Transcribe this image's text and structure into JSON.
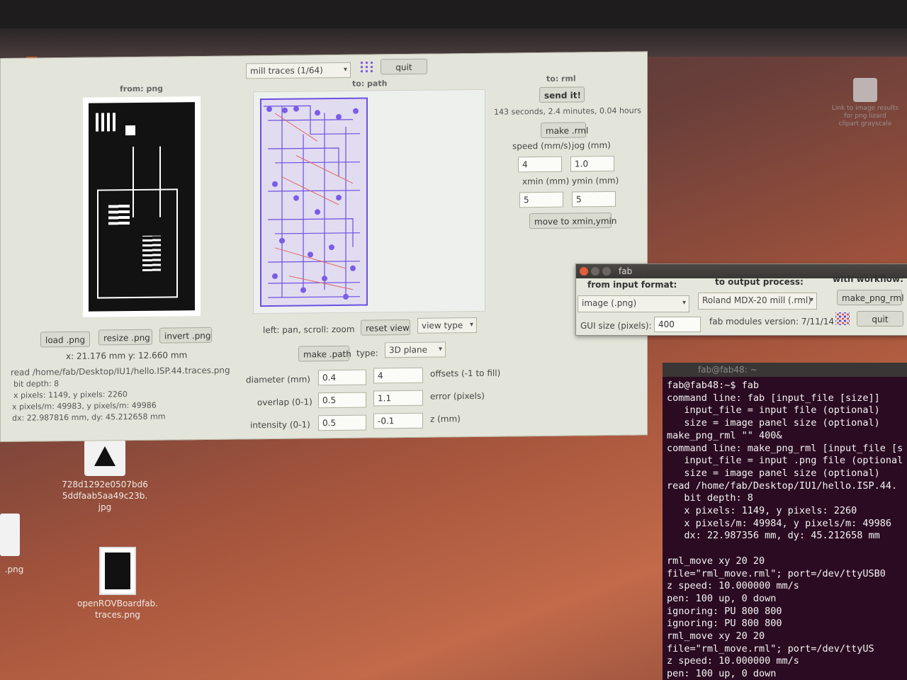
{
  "desktop": {
    "icons": [
      {
        "name": "728d1292e0507bd6\n5ddfaab5aa49c23b.\njpg"
      },
      {
        "name": "openROVBoardfab.\ntraces.png"
      },
      {
        "name": "Link to image results\nfor png lizard\nclipart grayscale"
      },
      {
        "name": ".png"
      }
    ]
  },
  "main": {
    "process_select": "mill traces (1/64)",
    "quit_label": "quit",
    "from_header": "from: png",
    "to_path_header": "to: path",
    "to_rml_header": "to: rml",
    "send_label": "send it!",
    "time_estimate": "143 seconds, 2.4 minutes, 0.04 hours",
    "make_rml_label": "make .rml",
    "speed_label": "speed (mm/s)",
    "jog_label": "jog (mm)",
    "speed_value": "4",
    "jog_value": "1.0",
    "xmin_label": "xmin (mm)",
    "ymin_label": "ymin (mm)",
    "xmin_value": "5",
    "ymin_value": "5",
    "move_label": "move to xmin,ymin",
    "load_label": "load .png",
    "resize_label": "resize .png",
    "invert_label": "invert .png",
    "cursor_pos": "x: 21.176 mm  y: 12.660 mm",
    "info_lines": [
      "read /home/fab/Desktop/IU1/hello.ISP.44.traces.png",
      "bit depth: 8",
      "x pixels: 1149, y pixels: 2260",
      "x pixels/m: 49983, y pixels/m: 49986",
      "dx: 22.987816 mm, dy: 45.212658 mm"
    ],
    "pan_hint": "left: pan, scroll: zoom",
    "reset_view_label": "reset view",
    "view_type_label": "view type",
    "make_path_label": "make .path",
    "type_label": "type:",
    "type_value": "3D plane",
    "diameter_label": "diameter (mm)",
    "diameter_value": "0.4",
    "offsets_value": "4",
    "offsets_label": "offsets (-1 to fill)",
    "overlap_label": "overlap (0-1)",
    "overlap_value": "0.5",
    "error_value": "1.1",
    "error_label": "error (pixels)",
    "intensity_label": "intensity (0-1)",
    "intensity_value": "0.5",
    "z_value": "-0.1",
    "z_label": "z (mm)"
  },
  "fab_dialog": {
    "title": "fab",
    "input_header": "from input format:",
    "output_header": "to output process:",
    "workflow_header": "with workflow:",
    "input_value": "image (.png)",
    "output_value": "Roland MDX-20 mill (.rml)",
    "workflow_value": "make_png_rml",
    "gui_size_label": "GUI size (pixels):",
    "gui_size_value": "400",
    "version": "fab modules version: 7/11/14",
    "quit_label": "quit"
  },
  "terminal": {
    "title": "fab@fab48: ~",
    "lines": [
      "fab@fab48:~$ fab",
      "command line: fab [input_file [size]]",
      "   input_file = input file (optional)",
      "   size = image panel size (optional)",
      "make_png_rml \"\" 400&",
      "command line: make_png_rml [input_file [s",
      "   input_file = input .png file (optional",
      "   size = image panel size (optional)",
      "read /home/fab/Desktop/IU1/hello.ISP.44.",
      "   bit depth: 8",
      "   x pixels: 1149, y pixels: 2260",
      "   x pixels/m: 49984, y pixels/m: 49986",
      "   dx: 22.987356 mm, dy: 45.212658 mm",
      "",
      "rml_move xy 20 20",
      "file=\"rml_move.rml\"; port=/dev/ttyUSB0",
      "z speed: 10.000000 mm/s",
      "pen: 100 up, 0 down",
      "ignoring: PU 800 800",
      "ignoring: PU 800 800",
      "rml_move xy 20 20",
      "file=\"rml_move.rml\"; port=/dev/ttyUS",
      "z speed: 10.000000 mm/s",
      "pen: 100 up, 0 down"
    ]
  }
}
